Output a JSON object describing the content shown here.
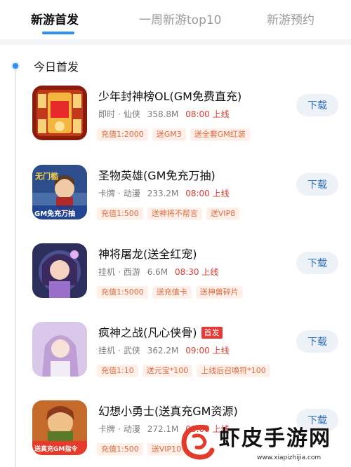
{
  "tabs": [
    {
      "label": "新游首发"
    },
    {
      "label": "一周新游top10"
    },
    {
      "label": "新游预约"
    }
  ],
  "section_title": "今日首发",
  "games": [
    {
      "title": "少年封神榜OL(GM免费直充)",
      "category": "即时",
      "subcategory": "仙侠",
      "size": "358.8M",
      "time": "08:00 上线",
      "tags": [
        "充值1:2000",
        "送GM3",
        "送全套GM红装"
      ],
      "button": "下载",
      "icon": "game-icon-fengshen"
    },
    {
      "title": "圣物英雄(GM免充万抽)",
      "category": "卡牌",
      "subcategory": "动漫",
      "size": "233.2M",
      "time": "08:00 上线",
      "tags": [
        "充值1:500",
        "送神将不帮言",
        "送VIP8"
      ],
      "icon_text": [
        "无门槛",
        "GM免充万抽"
      ],
      "button": "下载",
      "icon": "game-icon-hero"
    },
    {
      "title": "神将屠龙(送全红宠)",
      "category": "挂机",
      "subcategory": "西游",
      "size": "6.6M",
      "time": "08:30 上线",
      "tags": [
        "充值1:5000",
        "送充值卡",
        "送神兽碎片"
      ],
      "button": "下载",
      "icon": "game-icon-dragon"
    },
    {
      "title": "疯神之战(凡心侠骨)",
      "badge": "首发",
      "category": "挂机",
      "subcategory": "武侠",
      "size": "362.2M",
      "time": "09:00 上线",
      "tags": [
        "充值1:10",
        "送元宝*100",
        "上线后召唤符*100"
      ],
      "button": "下载",
      "icon": "game-icon-warrior"
    },
    {
      "title": "幻想小勇士(送真充GM资源)",
      "category": "卡牌",
      "subcategory": "动漫",
      "size": "272.1M",
      "time": "08:00 上线",
      "tags": [
        "充值1:500",
        "送VIP10"
      ],
      "icon_text": [
        "送真充GM指令"
      ],
      "button": "下载",
      "icon": "game-icon-braveheart"
    }
  ],
  "watermark": {
    "name": "虾皮手游网",
    "url": "www.xiapizhijia.com"
  },
  "colors": {
    "accent": "#2f8ff0",
    "time_red": "#e23b2e",
    "tag_text": "#e0673c",
    "tag_bg": "#fff1ea"
  }
}
